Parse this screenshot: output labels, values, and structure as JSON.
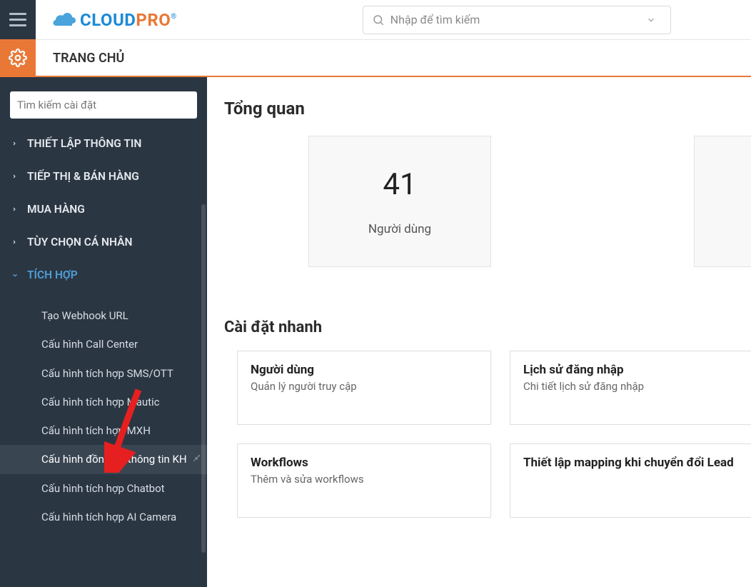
{
  "topbar": {
    "logo_blue": "CLOUD",
    "logo_orange": "PRO",
    "search_placeholder": "Nhập để tìm kiếm"
  },
  "secondbar": {
    "page_title": "TRANG CHỦ"
  },
  "sidebar": {
    "search_placeholder": "Tìm kiếm cài đặt",
    "nav": [
      {
        "label": "THIẾT LẬP THÔNG TIN",
        "expanded": false
      },
      {
        "label": "TIẾP THỊ & BÁN HÀNG",
        "expanded": false
      },
      {
        "label": "MUA HÀNG",
        "expanded": false
      },
      {
        "label": "TÙY CHỌN CÁ NHÂN",
        "expanded": false
      },
      {
        "label": "TÍCH HỢP",
        "expanded": true
      }
    ],
    "subitems": [
      "Tạo Webhook URL",
      "Cấu hình Call Center",
      "Cấu hình tích hợp SMS/OTT",
      "Cấu hình tích hợp Mautic",
      "Cấu hình tích hợp MXH",
      "Cấu hình đồng bộ thông tin KH",
      "Cấu hình tích hợp Chatbot",
      "Cấu hình tích hợp AI Camera"
    ]
  },
  "main": {
    "overview_title": "Tổng quan",
    "stat_value": "41",
    "stat_label": "Người dùng",
    "quick_title": "Cài đặt nhanh",
    "cards": [
      {
        "title": "Người dùng",
        "desc": "Quản lý người truy cập"
      },
      {
        "title": "Lịch sử đăng nhập",
        "desc": "Chi tiết lịch sử đăng nhập"
      },
      {
        "title": "Workflows",
        "desc": "Thêm và sửa workflows"
      },
      {
        "title": "Thiết lập mapping khi chuyển đổi Lead",
        "desc": ""
      }
    ]
  }
}
